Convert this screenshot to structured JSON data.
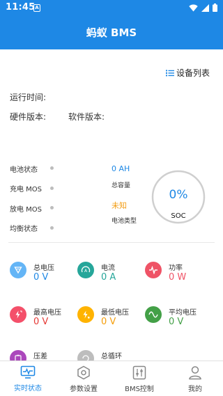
{
  "status_bar": {
    "time": "11:45",
    "notification_letter": "A"
  },
  "app_bar": {
    "title": "蚂蚁 BMS"
  },
  "device_list_label": "设备列表",
  "info": {
    "run_time_label": "运行时间:",
    "hardware_version_label": "硬件版本:",
    "software_version_label": "软件版本:"
  },
  "status_items": [
    {
      "label": "电池状态"
    },
    {
      "label": "充电 MOS"
    },
    {
      "label": "放电 MOS"
    },
    {
      "label": "均衡状态"
    }
  ],
  "capacity": {
    "value": "0 AH",
    "label": "总容量"
  },
  "battery_type": {
    "value": "未知",
    "label": "电池类型"
  },
  "soc": {
    "value": "0%",
    "label": "SOC"
  },
  "metrics": [
    {
      "label": "总电压",
      "value": "0 V",
      "icon": "triangle-icon",
      "color": "#64b5f6",
      "value_color": "#1e88e5"
    },
    {
      "label": "电流",
      "value": "0 A",
      "icon": "current-gauge-icon",
      "color": "#26a69a",
      "value_color": "#26a69a"
    },
    {
      "label": "功率",
      "value": "0 W",
      "icon": "pulse-icon",
      "color": "#ef5366",
      "value_color": "#ef5366"
    },
    {
      "label": "最高电压",
      "value": "0 V",
      "icon": "lightning-up-icon",
      "color": "#f4506a",
      "value_color": "#e53935"
    },
    {
      "label": "最低电压",
      "value": "0 V",
      "icon": "lightning-down-icon",
      "color": "#ffb300",
      "value_color": "#f59e0b"
    },
    {
      "label": "平均电压",
      "value": "0 V",
      "icon": "wave-icon",
      "color": "#43a047",
      "value_color": "#43a047"
    },
    {
      "label": "压差",
      "value": "",
      "icon": "battery-icon",
      "color": "#ab47bc",
      "value_color": "#ab47bc"
    },
    {
      "label": "总循环",
      "value": "",
      "icon": "cycle-icon",
      "color": "#9e9e9e",
      "value_color": "#333333"
    }
  ],
  "nav": [
    {
      "label": "实时状态",
      "icon": "monitor-icon",
      "active": true
    },
    {
      "label": "参数设置",
      "icon": "settings-hex-icon",
      "active": false
    },
    {
      "label": "BMS控制",
      "icon": "sliders-icon",
      "active": false
    },
    {
      "label": "我的",
      "icon": "person-icon",
      "active": false
    }
  ],
  "colors": {
    "primary": "#1e88e5",
    "orange": "#f39c12"
  }
}
